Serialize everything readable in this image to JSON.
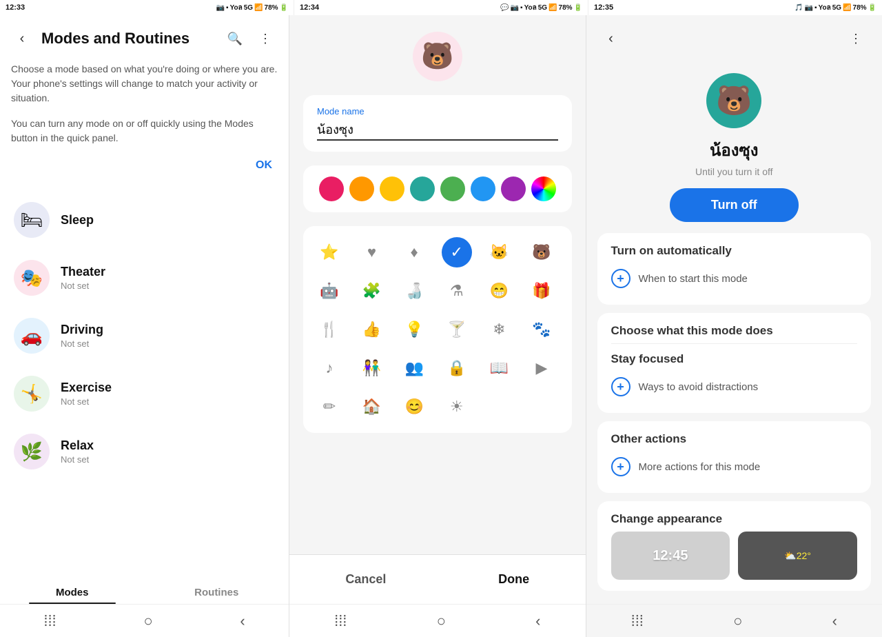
{
  "screens": {
    "screen1": {
      "time": "12:33",
      "title": "Modes and Routines",
      "desc1": "Choose a mode based on what you're doing or where you are. Your phone's settings will change to match your activity or situation.",
      "desc2": "You can turn any mode on or off quickly using the Modes button in the quick panel.",
      "ok_label": "OK",
      "modes": [
        {
          "name": "Sleep",
          "sub": "",
          "icon": "🛏",
          "iconClass": "sleep"
        },
        {
          "name": "Theater",
          "sub": "Not set",
          "icon": "🎭",
          "iconClass": "theater"
        },
        {
          "name": "Driving",
          "sub": "Not set",
          "icon": "🚗",
          "iconClass": "driving"
        },
        {
          "name": "Exercise",
          "sub": "Not set",
          "icon": "🤸",
          "iconClass": "exercise"
        },
        {
          "name": "Relax",
          "sub": "Not set",
          "icon": "🌿",
          "iconClass": "relax"
        }
      ],
      "tabs": [
        {
          "label": "Modes",
          "active": true
        },
        {
          "label": "Routines",
          "active": false
        }
      ]
    },
    "screen2": {
      "time": "12:34",
      "mode_name_label": "Mode name",
      "mode_name_value": "น้องซุง",
      "colors": [
        "#e91e63",
        "#ff9800",
        "#ffc107",
        "#26a69a",
        "#4caf50",
        "#2196f3",
        "#9c27b0",
        "#ff5722"
      ],
      "selected_color_index": 7,
      "cancel_label": "Cancel",
      "done_label": "Done",
      "icons": [
        "⭐",
        "❤️",
        "💎",
        "✔",
        "🐱",
        "🐻",
        "🤖",
        "🧩",
        "🍶",
        "🔬",
        "😁",
        "🎁",
        "🍴",
        "👍",
        "💡",
        "🍸",
        "❄",
        "🐾",
        "♪",
        "👫",
        "👥",
        "🔒",
        "📖",
        "▶",
        "✏",
        "🏠",
        "😊",
        "☀"
      ]
    },
    "screen3": {
      "time": "12:35",
      "hero_name": "น้องซุง",
      "hero_sub": "Until you turn it off",
      "turn_off_label": "Turn off",
      "turn_on_auto_title": "Turn on automatically",
      "turn_on_auto_sub": "When to start this mode",
      "choose_title": "Choose what this mode does",
      "stay_focused_title": "Stay focused",
      "stay_focused_sub": "Ways to avoid distractions",
      "other_actions_title": "Other actions",
      "other_actions_sub": "More actions for this mode",
      "appearance_title": "Change appearance",
      "thumb_time": "12:45",
      "thumb_weather": "⛅22°"
    }
  },
  "nav": {
    "icons": [
      "|||",
      "○",
      "<"
    ]
  }
}
